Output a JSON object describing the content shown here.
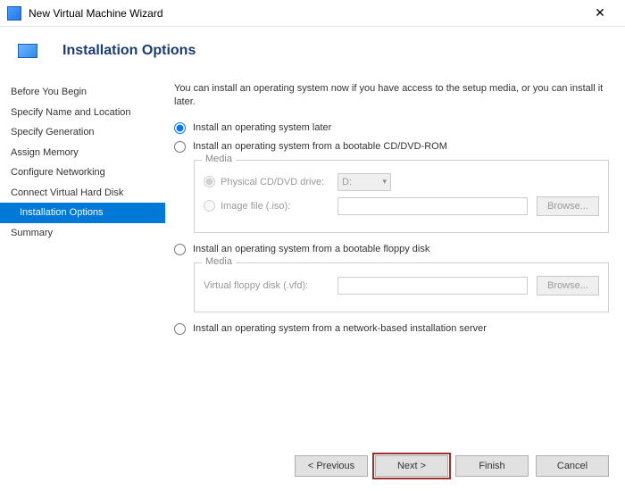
{
  "titlebar": {
    "text": "New Virtual Machine Wizard"
  },
  "header": {
    "title": "Installation Options"
  },
  "sidebar": [
    "Before You Begin",
    "Specify Name and Location",
    "Specify Generation",
    "Assign Memory",
    "Configure Networking",
    "Connect Virtual Hard Disk",
    "Installation Options",
    "Summary"
  ],
  "content": {
    "intro": "You can install an operating system now if you have access to the setup media, or you can install it later.",
    "opt_later": "Install an operating system later",
    "opt_cd": "Install an operating system from a bootable CD/DVD-ROM",
    "media_legend": "Media",
    "physical_drive": "Physical CD/DVD drive:",
    "drive_letter": "D:",
    "image_file": "Image file (.iso):",
    "browse": "Browse...",
    "opt_floppy": "Install an operating system from a bootable floppy disk",
    "floppy_label": "Virtual floppy disk (.vfd):",
    "opt_network": "Install an operating system from a network-based installation server"
  },
  "footer": {
    "previous": "< Previous",
    "next": "Next >",
    "finish": "Finish",
    "cancel": "Cancel"
  }
}
